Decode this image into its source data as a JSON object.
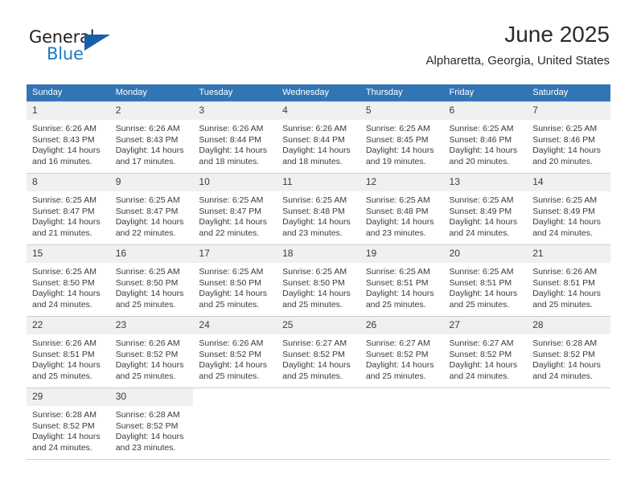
{
  "brand": {
    "word_one": "General",
    "word_two": "Blue",
    "triangle_icon": "triangle-icon",
    "accent_blue": "#1f7ac0",
    "dark_blue": "#1660a8",
    "text_dark": "#231f20"
  },
  "header": {
    "title": "June 2025",
    "subtitle": "Alpharetta, Georgia, United States"
  },
  "theme": {
    "header_row_bg": "#3275b5",
    "header_row_text": "#ffffff",
    "daynum_bg": "#f0f0f0",
    "cell_border": "#cfcfcf",
    "body_text": "#3a3a3a"
  },
  "weekdays": [
    "Sunday",
    "Monday",
    "Tuesday",
    "Wednesday",
    "Thursday",
    "Friday",
    "Saturday"
  ],
  "labels": {
    "sunrise_prefix": "Sunrise:",
    "sunset_prefix": "Sunset:",
    "daylight_prefix": "Daylight:"
  },
  "weeks": [
    [
      {
        "day": "1",
        "sunrise": "Sunrise: 6:26 AM",
        "sunset": "Sunset: 8:43 PM",
        "daylight": "Daylight: 14 hours and 16 minutes."
      },
      {
        "day": "2",
        "sunrise": "Sunrise: 6:26 AM",
        "sunset": "Sunset: 8:43 PM",
        "daylight": "Daylight: 14 hours and 17 minutes."
      },
      {
        "day": "3",
        "sunrise": "Sunrise: 6:26 AM",
        "sunset": "Sunset: 8:44 PM",
        "daylight": "Daylight: 14 hours and 18 minutes."
      },
      {
        "day": "4",
        "sunrise": "Sunrise: 6:26 AM",
        "sunset": "Sunset: 8:44 PM",
        "daylight": "Daylight: 14 hours and 18 minutes."
      },
      {
        "day": "5",
        "sunrise": "Sunrise: 6:25 AM",
        "sunset": "Sunset: 8:45 PM",
        "daylight": "Daylight: 14 hours and 19 minutes."
      },
      {
        "day": "6",
        "sunrise": "Sunrise: 6:25 AM",
        "sunset": "Sunset: 8:46 PM",
        "daylight": "Daylight: 14 hours and 20 minutes."
      },
      {
        "day": "7",
        "sunrise": "Sunrise: 6:25 AM",
        "sunset": "Sunset: 8:46 PM",
        "daylight": "Daylight: 14 hours and 20 minutes."
      }
    ],
    [
      {
        "day": "8",
        "sunrise": "Sunrise: 6:25 AM",
        "sunset": "Sunset: 8:47 PM",
        "daylight": "Daylight: 14 hours and 21 minutes."
      },
      {
        "day": "9",
        "sunrise": "Sunrise: 6:25 AM",
        "sunset": "Sunset: 8:47 PM",
        "daylight": "Daylight: 14 hours and 22 minutes."
      },
      {
        "day": "10",
        "sunrise": "Sunrise: 6:25 AM",
        "sunset": "Sunset: 8:47 PM",
        "daylight": "Daylight: 14 hours and 22 minutes."
      },
      {
        "day": "11",
        "sunrise": "Sunrise: 6:25 AM",
        "sunset": "Sunset: 8:48 PM",
        "daylight": "Daylight: 14 hours and 23 minutes."
      },
      {
        "day": "12",
        "sunrise": "Sunrise: 6:25 AM",
        "sunset": "Sunset: 8:48 PM",
        "daylight": "Daylight: 14 hours and 23 minutes."
      },
      {
        "day": "13",
        "sunrise": "Sunrise: 6:25 AM",
        "sunset": "Sunset: 8:49 PM",
        "daylight": "Daylight: 14 hours and 24 minutes."
      },
      {
        "day": "14",
        "sunrise": "Sunrise: 6:25 AM",
        "sunset": "Sunset: 8:49 PM",
        "daylight": "Daylight: 14 hours and 24 minutes."
      }
    ],
    [
      {
        "day": "15",
        "sunrise": "Sunrise: 6:25 AM",
        "sunset": "Sunset: 8:50 PM",
        "daylight": "Daylight: 14 hours and 24 minutes."
      },
      {
        "day": "16",
        "sunrise": "Sunrise: 6:25 AM",
        "sunset": "Sunset: 8:50 PM",
        "daylight": "Daylight: 14 hours and 25 minutes."
      },
      {
        "day": "17",
        "sunrise": "Sunrise: 6:25 AM",
        "sunset": "Sunset: 8:50 PM",
        "daylight": "Daylight: 14 hours and 25 minutes."
      },
      {
        "day": "18",
        "sunrise": "Sunrise: 6:25 AM",
        "sunset": "Sunset: 8:50 PM",
        "daylight": "Daylight: 14 hours and 25 minutes."
      },
      {
        "day": "19",
        "sunrise": "Sunrise: 6:25 AM",
        "sunset": "Sunset: 8:51 PM",
        "daylight": "Daylight: 14 hours and 25 minutes."
      },
      {
        "day": "20",
        "sunrise": "Sunrise: 6:25 AM",
        "sunset": "Sunset: 8:51 PM",
        "daylight": "Daylight: 14 hours and 25 minutes."
      },
      {
        "day": "21",
        "sunrise": "Sunrise: 6:26 AM",
        "sunset": "Sunset: 8:51 PM",
        "daylight": "Daylight: 14 hours and 25 minutes."
      }
    ],
    [
      {
        "day": "22",
        "sunrise": "Sunrise: 6:26 AM",
        "sunset": "Sunset: 8:51 PM",
        "daylight": "Daylight: 14 hours and 25 minutes."
      },
      {
        "day": "23",
        "sunrise": "Sunrise: 6:26 AM",
        "sunset": "Sunset: 8:52 PM",
        "daylight": "Daylight: 14 hours and 25 minutes."
      },
      {
        "day": "24",
        "sunrise": "Sunrise: 6:26 AM",
        "sunset": "Sunset: 8:52 PM",
        "daylight": "Daylight: 14 hours and 25 minutes."
      },
      {
        "day": "25",
        "sunrise": "Sunrise: 6:27 AM",
        "sunset": "Sunset: 8:52 PM",
        "daylight": "Daylight: 14 hours and 25 minutes."
      },
      {
        "day": "26",
        "sunrise": "Sunrise: 6:27 AM",
        "sunset": "Sunset: 8:52 PM",
        "daylight": "Daylight: 14 hours and 25 minutes."
      },
      {
        "day": "27",
        "sunrise": "Sunrise: 6:27 AM",
        "sunset": "Sunset: 8:52 PM",
        "daylight": "Daylight: 14 hours and 24 minutes."
      },
      {
        "day": "28",
        "sunrise": "Sunrise: 6:28 AM",
        "sunset": "Sunset: 8:52 PM",
        "daylight": "Daylight: 14 hours and 24 minutes."
      }
    ],
    [
      {
        "day": "29",
        "sunrise": "Sunrise: 6:28 AM",
        "sunset": "Sunset: 8:52 PM",
        "daylight": "Daylight: 14 hours and 24 minutes."
      },
      {
        "day": "30",
        "sunrise": "Sunrise: 6:28 AM",
        "sunset": "Sunset: 8:52 PM",
        "daylight": "Daylight: 14 hours and 23 minutes."
      },
      {
        "day": "",
        "sunrise": "",
        "sunset": "",
        "daylight": ""
      },
      {
        "day": "",
        "sunrise": "",
        "sunset": "",
        "daylight": ""
      },
      {
        "day": "",
        "sunrise": "",
        "sunset": "",
        "daylight": ""
      },
      {
        "day": "",
        "sunrise": "",
        "sunset": "",
        "daylight": ""
      },
      {
        "day": "",
        "sunrise": "",
        "sunset": "",
        "daylight": ""
      }
    ]
  ]
}
